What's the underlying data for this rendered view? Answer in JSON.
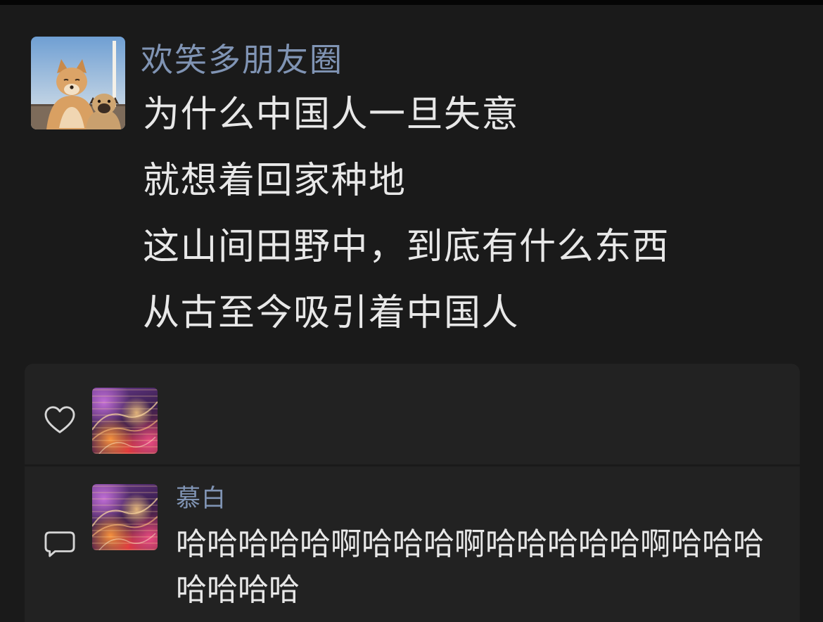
{
  "post": {
    "author": "欢笑多朋友圈",
    "lines": [
      "为什么中国人一旦失意",
      "就想着回家种地",
      "这山间田野中，到底有什么东西",
      "从古至今吸引着中国人"
    ]
  },
  "likes": {
    "icon": "heart-icon"
  },
  "comments": [
    {
      "icon": "comment-icon",
      "author": "慕白",
      "text": "哈哈哈哈哈啊哈哈哈啊哈哈哈哈哈啊哈哈哈哈哈哈哈"
    }
  ],
  "colors": {
    "background": "#1a1a1a",
    "panel": "#222222",
    "name": "#8094b4",
    "text": "#e8e8e8"
  }
}
